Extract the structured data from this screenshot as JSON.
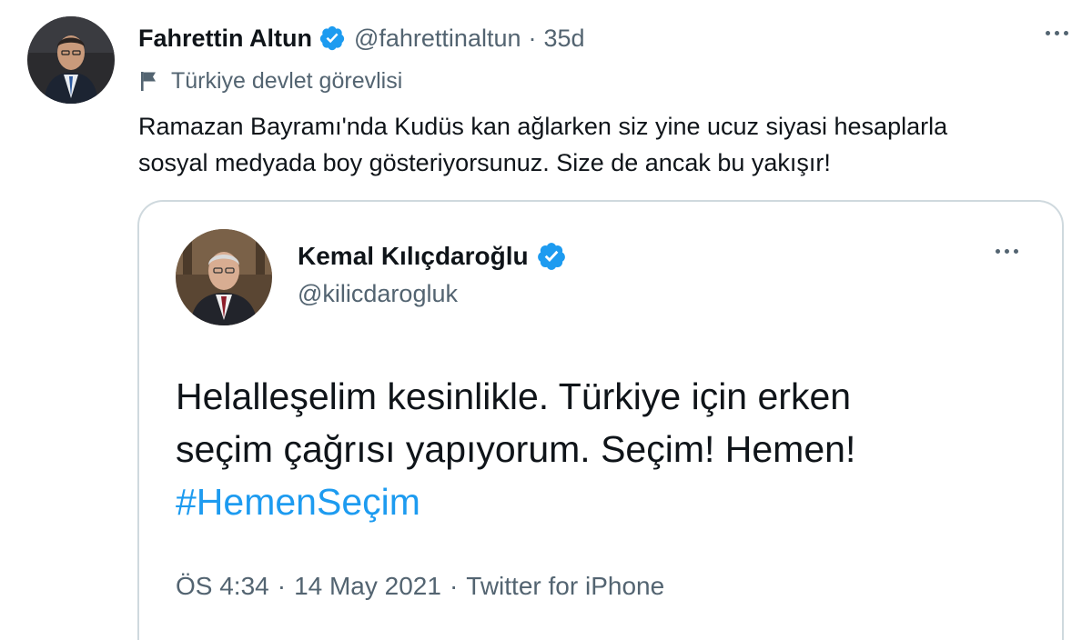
{
  "tweet": {
    "author": {
      "display_name": "Fahrettin Altun",
      "handle": "@fahrettinaltun",
      "verified": true
    },
    "time_ago": "35d",
    "dot": "·",
    "label": {
      "icon": "flag-icon",
      "text": "Türkiye devlet görevlisi"
    },
    "text": "Ramazan Bayramı'nda Kudüs kan ağlarken siz yine ucuz siyasi hesaplarla\nsosyal medyada boy gösteriyorsunuz. Size de ancak bu yakışır!",
    "more_icon": "more-horizontal-icon"
  },
  "quoted_tweet": {
    "author": {
      "display_name": "Kemal Kılıçdaroğlu",
      "handle": "@kilicdarogluk",
      "verified": true
    },
    "text_lines": [
      "Helalleşelim kesinlikle. Türkiye için erken",
      "seçim çağrısı yapıyorum. Seçim! Hemen!"
    ],
    "hashtag": "#HemenSeçim",
    "time": "ÖS 4:34",
    "date": "14 May 2021",
    "source": "Twitter for iPhone",
    "sep": "·",
    "more_icon": "more-horizontal-icon"
  },
  "colors": {
    "text": "#0f1419",
    "secondary": "#536471",
    "accent": "#1d9bf0",
    "border": "#cfd9de"
  }
}
